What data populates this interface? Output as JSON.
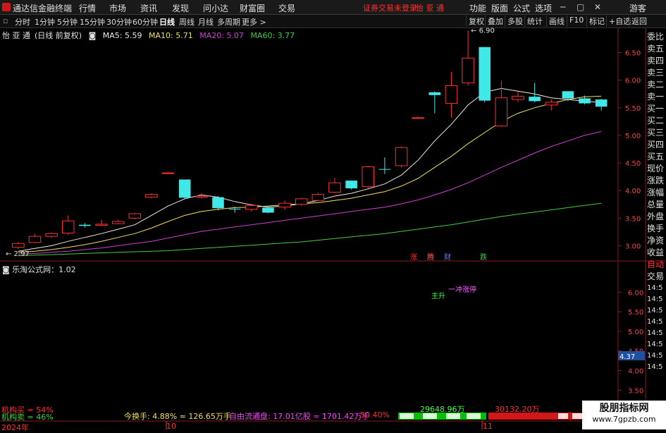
{
  "menubar": {
    "app_title": "通达信金融终端",
    "items": [
      "行情",
      "市场",
      "资讯",
      "发现",
      "问小达",
      "财富圈",
      "交易"
    ],
    "status": "证券交易未登录",
    "stock_name_top": "怡 亚 通",
    "right_items": [
      "功能",
      "版面",
      "公式",
      "选项"
    ],
    "guest": "游客"
  },
  "toolbar": {
    "periods": [
      "分时",
      "1分钟",
      "5分钟",
      "15分钟",
      "30分钟",
      "60分钟",
      "日线",
      "周线",
      "月线",
      "多周期",
      "更多 >"
    ],
    "active_period": "日线",
    "right_buttons": [
      "复权",
      "叠加",
      "多股",
      "统计",
      "画线",
      "F10",
      "标记",
      "+自选",
      "返回"
    ]
  },
  "chart_header": {
    "stock": "怡 亚 通",
    "mode": "(日线 前复权)",
    "ma5": "MA5: 5.59",
    "ma10": "MA10: 5.71",
    "ma20": "MA20: 5.07",
    "ma60": "MA60: 3.77"
  },
  "side_labels": [
    "委比",
    "卖五",
    "卖四",
    "卖三",
    "卖二",
    "卖一",
    "买一",
    "买二",
    "买三",
    "买四",
    "买五",
    "现价",
    "涨跌",
    "涨幅",
    "总量",
    "外盘",
    "换手",
    "净资",
    "收益",
    "自动",
    "交易"
  ],
  "side_times": [
    "14:5",
    "14:5",
    "14:5",
    "14:5",
    "14:5",
    "14:5",
    "14:5",
    "14:5"
  ],
  "subchart": {
    "title": "乐淘公式网：1.02",
    "labels": [
      "主升",
      "一冲涨停"
    ]
  },
  "markers": [
    "涨",
    "腾",
    "财",
    "跌"
  ],
  "bottom": {
    "jigou_buy": "机构买 = 54%",
    "jigou_sell": "机构卖 = 46%",
    "turnover": "今换手: 4.88% ≈ 126.65万手",
    "middle_text": "自由流通盘: 17.01亿股 ≈ 1701.42万手",
    "pct": "50.40%",
    "vol_left": "29648.96万",
    "vol_right": "30132.20万",
    "year_label": "2024年",
    "month_10": "10",
    "month_11": "11"
  },
  "price_axis": [
    "6.50",
    "6.00",
    "5.50",
    "5.00",
    "4.50",
    "4.00",
    "3.50",
    "3.00"
  ],
  "sub_axis": [
    "6.00",
    "5.50",
    "5.00",
    "4.50",
    "4.37",
    "4.00",
    "3.50"
  ],
  "peak_label": "6.90",
  "low_label": "2.97",
  "current_sub_value": "4.37",
  "watermark": {
    "line1": "股朋指标网",
    "line2": "www.7gpzb.com"
  },
  "chart_data": {
    "type": "candlestick",
    "title": "怡 亚 通",
    "ylim": [
      2.75,
      6.75
    ],
    "note": "approximate OHLC values estimated from rendered candles",
    "candles": [
      {
        "o": 2.97,
        "c": 3.04,
        "h": 3.07,
        "l": 2.94
      },
      {
        "o": 3.06,
        "c": 3.17,
        "h": 3.22,
        "l": 3.05
      },
      {
        "o": 3.17,
        "c": 3.22,
        "h": 3.24,
        "l": 3.14
      },
      {
        "o": 3.23,
        "c": 3.45,
        "h": 3.55,
        "l": 3.2
      },
      {
        "o": 3.38,
        "c": 3.36,
        "h": 3.41,
        "l": 3.33
      },
      {
        "o": 3.37,
        "c": 3.39,
        "h": 3.47,
        "l": 3.36
      },
      {
        "o": 3.4,
        "c": 3.44,
        "h": 3.47,
        "l": 3.39
      },
      {
        "o": 3.5,
        "c": 3.58,
        "h": 3.6,
        "l": 3.48
      },
      {
        "o": 3.88,
        "c": 3.93,
        "h": 3.95,
        "l": 3.86
      },
      {
        "o": 4.31,
        "c": 4.32,
        "h": 4.34,
        "l": 4.3
      },
      {
        "o": 4.2,
        "c": 3.87,
        "h": 4.2,
        "l": 3.85
      },
      {
        "o": 3.88,
        "c": 3.9,
        "h": 3.95,
        "l": 3.85
      },
      {
        "o": 3.88,
        "c": 3.68,
        "h": 3.9,
        "l": 3.64
      },
      {
        "o": 3.67,
        "c": 3.66,
        "h": 3.71,
        "l": 3.6
      },
      {
        "o": 3.66,
        "c": 3.73,
        "h": 3.76,
        "l": 3.62
      },
      {
        "o": 3.69,
        "c": 3.6,
        "h": 3.7,
        "l": 3.59
      },
      {
        "o": 3.7,
        "c": 3.77,
        "h": 3.82,
        "l": 3.65
      },
      {
        "o": 3.75,
        "c": 3.85,
        "h": 3.87,
        "l": 3.72
      },
      {
        "o": 3.82,
        "c": 3.93,
        "h": 3.96,
        "l": 3.8
      },
      {
        "o": 3.97,
        "c": 4.14,
        "h": 4.23,
        "l": 3.95
      },
      {
        "o": 4.18,
        "c": 4.04,
        "h": 4.18,
        "l": 4.02
      },
      {
        "o": 4.07,
        "c": 4.43,
        "h": 4.45,
        "l": 4.04
      },
      {
        "o": 4.39,
        "c": 4.38,
        "h": 4.6,
        "l": 4.3
      },
      {
        "o": 4.45,
        "c": 4.78,
        "h": 4.8,
        "l": 4.42
      },
      {
        "o": 5.31,
        "c": 5.32,
        "h": 5.34,
        "l": 5.3
      },
      {
        "o": 5.78,
        "c": 5.73,
        "h": 5.8,
        "l": 5.4
      },
      {
        "o": 5.58,
        "c": 5.9,
        "h": 6.15,
        "l": 5.32
      },
      {
        "o": 5.95,
        "c": 6.4,
        "h": 6.9,
        "l": 5.9
      },
      {
        "o": 6.6,
        "c": 5.63,
        "h": 6.6,
        "l": 5.6
      },
      {
        "o": 5.17,
        "c": 5.68,
        "h": 5.99,
        "l": 5.15
      },
      {
        "o": 5.65,
        "c": 5.71,
        "h": 5.8,
        "l": 5.6
      },
      {
        "o": 5.7,
        "c": 5.62,
        "h": 5.95,
        "l": 5.6
      },
      {
        "o": 5.55,
        "c": 5.6,
        "h": 5.65,
        "l": 5.45
      },
      {
        "o": 5.8,
        "c": 5.67,
        "h": 5.8,
        "l": 5.62
      },
      {
        "o": 5.67,
        "c": 5.58,
        "h": 5.72,
        "l": 5.56
      },
      {
        "o": 5.65,
        "c": 5.52,
        "h": 5.66,
        "l": 5.45
      }
    ],
    "ma5": [
      2.9,
      2.95,
      3.0,
      3.08,
      3.15,
      3.22,
      3.3,
      3.38,
      3.55,
      3.72,
      3.85,
      3.92,
      3.88,
      3.8,
      3.74,
      3.7,
      3.72,
      3.76,
      3.82,
      3.9,
      3.95,
      4.03,
      4.12,
      4.28,
      4.55,
      4.9,
      5.2,
      5.55,
      5.78,
      5.85,
      5.8,
      5.75,
      5.68,
      5.65,
      5.62,
      5.59
    ],
    "ma10": [
      2.88,
      2.9,
      2.93,
      2.97,
      3.02,
      3.08,
      3.15,
      3.22,
      3.32,
      3.44,
      3.55,
      3.62,
      3.66,
      3.69,
      3.7,
      3.72,
      3.74,
      3.76,
      3.78,
      3.82,
      3.86,
      3.92,
      3.98,
      4.08,
      4.22,
      4.42,
      4.62,
      4.85,
      5.05,
      5.25,
      5.4,
      5.5,
      5.58,
      5.65,
      5.7,
      5.71
    ],
    "ma20": [
      2.85,
      2.86,
      2.88,
      2.9,
      2.93,
      2.96,
      3.0,
      3.04,
      3.08,
      3.14,
      3.2,
      3.26,
      3.3,
      3.34,
      3.38,
      3.42,
      3.46,
      3.5,
      3.54,
      3.58,
      3.62,
      3.66,
      3.7,
      3.76,
      3.83,
      3.92,
      4.02,
      4.14,
      4.28,
      4.42,
      4.55,
      4.68,
      4.8,
      4.9,
      5.0,
      5.07
    ],
    "ma60": [
      2.82,
      2.83,
      2.84,
      2.85,
      2.86,
      2.87,
      2.88,
      2.89,
      2.9,
      2.91,
      2.93,
      2.95,
      2.97,
      2.99,
      3.01,
      3.03,
      3.05,
      3.07,
      3.1,
      3.13,
      3.16,
      3.19,
      3.22,
      3.26,
      3.3,
      3.34,
      3.38,
      3.43,
      3.48,
      3.53,
      3.57,
      3.61,
      3.65,
      3.69,
      3.73,
      3.77
    ]
  }
}
